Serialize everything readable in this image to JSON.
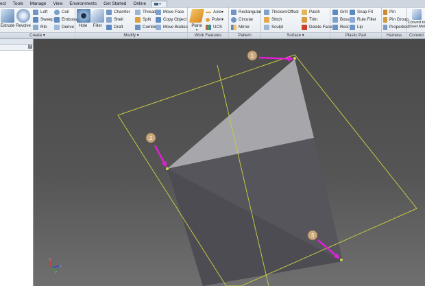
{
  "menu": {
    "items": [
      "ect",
      "Tools",
      "Manage",
      "View",
      "Environments",
      "Get Started",
      "Online"
    ]
  },
  "ribbon": {
    "create": {
      "title": "Create",
      "extrude": "Extrude",
      "revolve": "Revolve",
      "loft": "Loft",
      "sweep": "Sweep",
      "rib": "Rib",
      "coil": "Coil",
      "emboss": "Emboss",
      "derive": "Derive"
    },
    "modify": {
      "title": "Modify",
      "hole": "Hole",
      "fillet": "Fillet",
      "chamfer": "Chamfer",
      "shell": "Shell",
      "draft": "Draft",
      "thread": "Thread",
      "split": "Split",
      "combine": "Combine",
      "move_face": "Move Face",
      "copy_object": "Copy Object",
      "move_bodies": "Move Bodies"
    },
    "work_features": {
      "title": "Work Features",
      "plane": "Plane",
      "axis": "Axis",
      "point": "Point",
      "ucs": "UCS"
    },
    "pattern": {
      "title": "Pattern",
      "rectangular": "Rectangular",
      "circular": "Circular",
      "mirror": "Mirror"
    },
    "surface": {
      "title": "Surface",
      "thicken_offset": "Thicken/Offset",
      "stitch": "Stitch",
      "sculpt": "Sculpt",
      "patch": "Patch",
      "trim": "Trim",
      "delete_face": "Delete Face"
    },
    "plastic_part": {
      "title": "Plastic Part",
      "grill": "Grill",
      "boss": "Boss",
      "rest": "Rest",
      "snap_fit": "Snap Fit",
      "rule_fillet": "Rule Fillet",
      "lip": "Lip"
    },
    "harness": {
      "title": "Harness",
      "pin": "Pin",
      "pin_group": "Pin Group",
      "properties": "Properties"
    },
    "convert": {
      "title": "Convert",
      "convert_to_sheet_metal": "Convert to Sheet Metal"
    }
  },
  "browser": {
    "help": "?"
  },
  "viewport": {
    "markers": [
      "1",
      "2",
      "3"
    ],
    "triad": {
      "x": "X",
      "y": "Y",
      "z": "Z"
    }
  },
  "colors": {
    "annotation_arrow": "#e020d8",
    "marker_fill": "#c9a77d",
    "plane_outline": "#c8c843",
    "surface_light": "#a7a7ab",
    "surface_dark": "#4d4c53"
  }
}
